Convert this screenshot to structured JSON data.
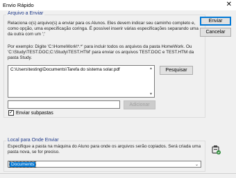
{
  "window": {
    "title": "Envio Rápido",
    "close_glyph": "✕"
  },
  "files_section": {
    "legend": "Arquivo a Enviar",
    "description": "Relaciona o(s) arquivo(s) a enviar para os Alunos. Eles devem indicar seu caminho completo e, como opção, uma especificação coringa. É possível inserir várias especificações separando uma da outra com um ';'",
    "example": "Por exemplo: Digite 'C:\\HomeWork\\*.*' para incluir todos os arquivos da pasta HomeWork. Ou 'C:\\Study\\TEST.DOC;C:\\Study\\TEST.HTM' para enviar os arquivos TEST.DOC e TEST.HTM da pasta Study.",
    "files": [
      "C:\\Users\\testing\\Documents\\Tarefa do sistema solar.pdf"
    ],
    "browse_label": "Pesquisar",
    "new_file_value": "",
    "add_label": "Adicionar",
    "send_subfolders_label": "Enviar subpastas",
    "send_subfolders_checked": true
  },
  "dest_section": {
    "legend": "Local para Onde Enviar",
    "description": "Especifique a pasta na máquina do Aluno para onde os arquivos serão copiados. Será criada uma pasta nova, se for preciso.",
    "selected": "Documents",
    "icon": "student-machine-icon"
  },
  "buttons": {
    "send": "Enviar",
    "cancel": "Cancelar"
  },
  "colors": {
    "accent": "#0078d7",
    "legend": "#1f3a8a"
  }
}
